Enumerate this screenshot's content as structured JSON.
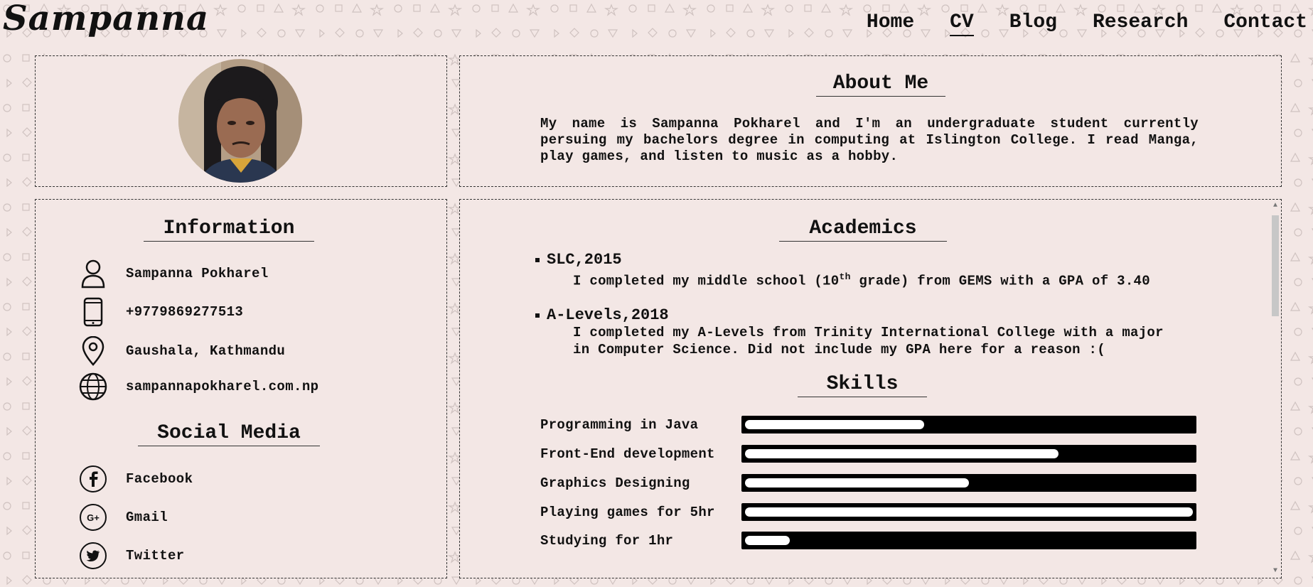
{
  "site": {
    "logo": "Sampanna"
  },
  "nav": [
    {
      "label": "Home"
    },
    {
      "label": "CV",
      "active": true
    },
    {
      "label": "Blog"
    },
    {
      "label": "Research"
    },
    {
      "label": "Contact"
    }
  ],
  "about": {
    "title": "About Me",
    "text": "My name is Sampanna Pokharel and I'm an undergraduate student currently persuing my bachelors degree in computing at Islington College. I read Manga, play games, and listen to music as a hobby."
  },
  "information": {
    "title": "Information",
    "items": [
      {
        "icon": "person-icon",
        "text": "Sampanna Pokharel"
      },
      {
        "icon": "phone-icon",
        "text": "+9779869277513"
      },
      {
        "icon": "location-pin-icon",
        "text": "Gaushala, Kathmandu"
      },
      {
        "icon": "globe-icon",
        "text": "sampannapokharel.com.np"
      }
    ]
  },
  "social": {
    "title": "Social Media",
    "items": [
      {
        "icon": "facebook-icon",
        "text": "Facebook"
      },
      {
        "icon": "google-plus-icon",
        "text": "Gmail"
      },
      {
        "icon": "twitter-icon",
        "text": "Twitter"
      }
    ]
  },
  "academics": {
    "title": "Academics",
    "items": [
      {
        "heading": "SLC,2015",
        "desc_before": "I completed my middle school (10",
        "desc_sup": "th",
        "desc_after": " grade) from GEMS with a GPA of 3.40"
      },
      {
        "heading": "A-Levels,2018",
        "desc": "I completed my A-Levels from Trinity International College with a major in Computer Science. Did not include my GPA here for a reason :("
      }
    ]
  },
  "skills": {
    "title": "Skills",
    "items": [
      {
        "label": "Programming in Java",
        "level": 0.4
      },
      {
        "label": "Front-End development",
        "level": 0.7
      },
      {
        "label": "Graphics Designing",
        "level": 0.5
      },
      {
        "label": "Playing games for 5hr",
        "level": 1.0
      },
      {
        "label": "Studying for 1hr",
        "level": 0.1
      }
    ]
  },
  "colors": {
    "background": "#f3e7e5",
    "text": "#111111",
    "bar": "#000000",
    "bar_fill": "#ffffff"
  }
}
